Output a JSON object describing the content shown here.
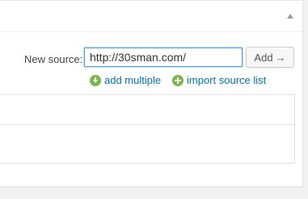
{
  "source_form": {
    "label": "New source:",
    "input_value": "http://30sman.com/",
    "add_button_label": "Add",
    "add_button_icon": "right-arrow-icon"
  },
  "links": {
    "add_multiple": {
      "label": "add multiple",
      "icon": "down-arrow-circle-icon"
    },
    "import_source_list": {
      "label": "import source list",
      "icon": "plus-circle-icon"
    }
  },
  "colors": {
    "link": "#0073aa",
    "icon_green": "#7ab648",
    "input_focus": "#5b9dd9"
  }
}
